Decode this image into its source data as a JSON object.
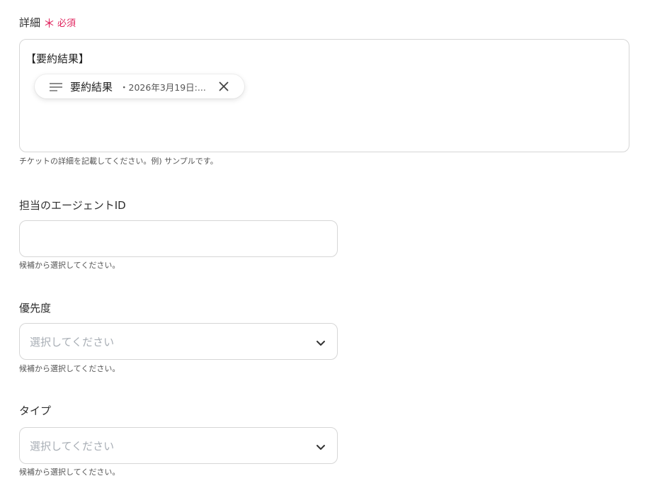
{
  "details": {
    "label": "詳細",
    "required_mark": "＊",
    "required_text": "必須",
    "text_value": "【要約結果】",
    "chip": {
      "icon": "text-lines-icon",
      "label": "要約結果",
      "meta": "・2026年3月19日:..."
    },
    "help": "チケットの詳細を記載してください。例) サンプルです。"
  },
  "agent": {
    "label": "担当のエージェントID",
    "value": "",
    "help": "候補から選択してください。"
  },
  "priority": {
    "label": "優先度",
    "placeholder": "選択してください",
    "help": "候補から選択してください。"
  },
  "type": {
    "label": "タイプ",
    "placeholder": "選択してください",
    "help": "候補から選択してください。"
  },
  "colors": {
    "required": "#e0245e",
    "border": "#d6d6d6",
    "placeholder": "#a8aeb5"
  }
}
